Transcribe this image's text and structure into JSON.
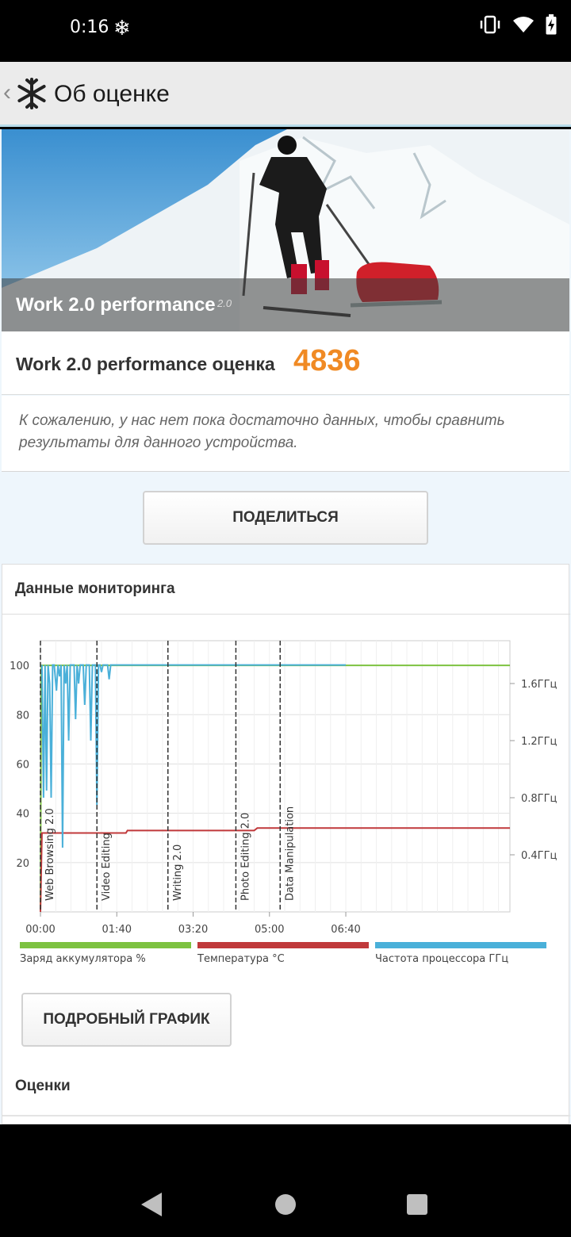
{
  "status_bar": {
    "time": "0:16",
    "icons": [
      "snowflake-notification-icon",
      "vibrate-icon",
      "wifi-icon",
      "battery-charging-icon"
    ]
  },
  "app_bar": {
    "title": "Об оценке"
  },
  "hero": {
    "title": "Work 2.0 performance",
    "version": "2.0"
  },
  "score": {
    "label": "Work 2.0 performance оценка",
    "value": "4836",
    "color": "#f08a24"
  },
  "info": {
    "text": "К сожалению, у нас нет пока достаточно данных, чтобы сравнить результаты для данного устройства."
  },
  "share_button": "ПОДЕЛИТЬСЯ",
  "monitoring": {
    "title": "Данные мониторинга",
    "legend": [
      {
        "label": "Заряд аккумулятора %",
        "color": "#7dc241"
      },
      {
        "label": "Температура °C",
        "color": "#c0393b"
      },
      {
        "label": "Частота процессора ГГц",
        "color": "#4ab0d9"
      }
    ]
  },
  "detail_button": "ПОДРОБНЫЙ ГРАФИК",
  "scores_title": "Оценки",
  "chart_data": {
    "type": "line",
    "x_ticks": [
      "00:00",
      "01:40",
      "03:20",
      "05:00",
      "06:40"
    ],
    "x_range_seconds": [
      0,
      615
    ],
    "y_left_ticks": [
      "20",
      "40",
      "60",
      "80",
      "100"
    ],
    "y_left_range": [
      0,
      110
    ],
    "y_right_ticks": [
      "0.4ГГц",
      "0.8ГГц",
      "1.2ГГц",
      "1.6ГГц"
    ],
    "y_right_range_ghz": [
      0,
      1.9
    ],
    "grid": true,
    "sections": [
      {
        "label": "Web Browsing 2.0",
        "start_seconds": 0
      },
      {
        "label": "Video Editing",
        "start_seconds": 74
      },
      {
        "label": "Writing 2.0",
        "start_seconds": 167
      },
      {
        "label": "Photo Editing 2.0",
        "start_seconds": 256
      },
      {
        "label": "Data Manipulation",
        "start_seconds": 314
      }
    ],
    "series": [
      {
        "name": "Заряд аккумулятора %",
        "color": "#7dc241",
        "axis": "left",
        "points": [
          [
            0,
            0
          ],
          [
            1,
            100
          ],
          [
            615,
            100
          ]
        ]
      },
      {
        "name": "Температура °C",
        "color": "#c0393b",
        "axis": "left",
        "points": [
          [
            0,
            0
          ],
          [
            2,
            32
          ],
          [
            112,
            32
          ],
          [
            114,
            33
          ],
          [
            280,
            33
          ],
          [
            284,
            34
          ],
          [
            615,
            34
          ]
        ]
      },
      {
        "name": "Частота процессора ГГц",
        "color": "#4ab0d9",
        "axis": "right",
        "points": [
          [
            2,
            1.73
          ],
          [
            4,
            0.8
          ],
          [
            6,
            1.73
          ],
          [
            8,
            0.85
          ],
          [
            10,
            1.73
          ],
          [
            12,
            1.6
          ],
          [
            14,
            0.8
          ],
          [
            16,
            1.73
          ],
          [
            18,
            1.73
          ],
          [
            21,
            1.55
          ],
          [
            23,
            1.73
          ],
          [
            25,
            1.65
          ],
          [
            27,
            1.73
          ],
          [
            29,
            0.45
          ],
          [
            31,
            1.73
          ],
          [
            33,
            1.6
          ],
          [
            35,
            1.73
          ],
          [
            37,
            1.2
          ],
          [
            39,
            1.73
          ],
          [
            41,
            1.73
          ],
          [
            44,
            1.73
          ],
          [
            46,
            1.35
          ],
          [
            48,
            1.73
          ],
          [
            50,
            1.6
          ],
          [
            52,
            1.73
          ],
          [
            54,
            1.73
          ],
          [
            56,
            1.73
          ],
          [
            58,
            1.45
          ],
          [
            60,
            1.73
          ],
          [
            62,
            1.73
          ],
          [
            64,
            1.73
          ],
          [
            66,
            1.2
          ],
          [
            68,
            1.73
          ],
          [
            70,
            1.73
          ],
          [
            72,
            1.73
          ],
          [
            74,
            0.75
          ],
          [
            76,
            1.73
          ],
          [
            78,
            1.73
          ],
          [
            80,
            1.68
          ],
          [
            82,
            1.73
          ],
          [
            84,
            1.73
          ],
          [
            86,
            1.73
          ],
          [
            88,
            1.73
          ],
          [
            90,
            1.63
          ],
          [
            92,
            1.73
          ],
          [
            94,
            1.73
          ],
          [
            96,
            1.73
          ],
          [
            98,
            1.73
          ],
          [
            100,
            1.73
          ],
          [
            102,
            1.73
          ],
          [
            104,
            1.73
          ],
          [
            106,
            1.73
          ],
          [
            108,
            1.73
          ],
          [
            110,
            1.73
          ],
          [
            112,
            1.73
          ],
          [
            114,
            1.73
          ],
          [
            116,
            1.73
          ],
          [
            118,
            1.73
          ],
          [
            120,
            1.73
          ],
          [
            122,
            1.73
          ],
          [
            124,
            1.73
          ],
          [
            126,
            1.73
          ],
          [
            128,
            1.73
          ],
          [
            130,
            1.73
          ],
          [
            132,
            1.73
          ],
          [
            134,
            1.73
          ],
          [
            136,
            1.73
          ],
          [
            138,
            1.73
          ],
          [
            140,
            1.73
          ],
          [
            142,
            1.73
          ],
          [
            144,
            1.73
          ],
          [
            146,
            1.73
          ],
          [
            148,
            1.73
          ],
          [
            150,
            1.73
          ],
          [
            152,
            1.73
          ],
          [
            154,
            1.73
          ],
          [
            156,
            1.73
          ],
          [
            158,
            1.73
          ],
          [
            160,
            1.73
          ],
          [
            162,
            1.73
          ],
          [
            164,
            1.73
          ],
          [
            166,
            1.73
          ],
          [
            168,
            1.73
          ],
          [
            170,
            1.73
          ],
          [
            172,
            1.73
          ],
          [
            174,
            1.73
          ],
          [
            176,
            1.73
          ],
          [
            178,
            1.73
          ],
          [
            180,
            1.73
          ],
          [
            182,
            1.73
          ],
          [
            184,
            1.73
          ],
          [
            186,
            1.73
          ],
          [
            188,
            1.73
          ],
          [
            190,
            1.73
          ],
          [
            192,
            1.73
          ],
          [
            194,
            1.73
          ],
          [
            196,
            1.73
          ],
          [
            198,
            1.73
          ],
          [
            200,
            1.73
          ],
          [
            202,
            1.73
          ],
          [
            204,
            1.73
          ],
          [
            206,
            1.73
          ],
          [
            208,
            1.73
          ],
          [
            210,
            1.73
          ],
          [
            212,
            1.73
          ],
          [
            214,
            1.73
          ],
          [
            216,
            1.73
          ],
          [
            218,
            1.73
          ],
          [
            220,
            1.73
          ],
          [
            222,
            1.73
          ],
          [
            224,
            1.73
          ],
          [
            226,
            1.73
          ],
          [
            228,
            1.73
          ],
          [
            230,
            1.73
          ],
          [
            232,
            1.73
          ],
          [
            234,
            1.73
          ],
          [
            236,
            1.73
          ],
          [
            238,
            1.73
          ],
          [
            240,
            1.73
          ],
          [
            242,
            1.73
          ],
          [
            244,
            1.73
          ],
          [
            246,
            1.73
          ],
          [
            248,
            1.73
          ],
          [
            250,
            1.73
          ],
          [
            252,
            1.73
          ],
          [
            254,
            1.73
          ],
          [
            256,
            1.73
          ],
          [
            258,
            1.73
          ],
          [
            260,
            1.73
          ],
          [
            262,
            1.73
          ],
          [
            264,
            1.73
          ],
          [
            266,
            1.73
          ],
          [
            268,
            1.73
          ],
          [
            270,
            1.73
          ],
          [
            272,
            1.73
          ],
          [
            274,
            1.73
          ],
          [
            276,
            1.73
          ],
          [
            278,
            1.73
          ],
          [
            280,
            1.73
          ],
          [
            282,
            1.73
          ],
          [
            284,
            1.73
          ],
          [
            286,
            1.73
          ],
          [
            288,
            1.73
          ],
          [
            290,
            1.73
          ],
          [
            292,
            1.73
          ],
          [
            294,
            1.73
          ],
          [
            296,
            1.73
          ],
          [
            298,
            1.73
          ],
          [
            300,
            1.73
          ],
          [
            302,
            1.73
          ],
          [
            304,
            1.73
          ],
          [
            306,
            1.73
          ],
          [
            308,
            1.73
          ],
          [
            310,
            1.73
          ],
          [
            312,
            1.73
          ],
          [
            314,
            1.73
          ],
          [
            316,
            1.73
          ],
          [
            318,
            1.73
          ],
          [
            320,
            1.73
          ],
          [
            322,
            1.73
          ],
          [
            324,
            1.73
          ],
          [
            326,
            1.73
          ],
          [
            328,
            1.73
          ],
          [
            330,
            1.73
          ],
          [
            332,
            1.73
          ],
          [
            334,
            1.73
          ],
          [
            336,
            1.73
          ],
          [
            338,
            1.73
          ],
          [
            340,
            1.73
          ],
          [
            342,
            1.73
          ],
          [
            344,
            1.73
          ],
          [
            346,
            1.73
          ],
          [
            348,
            1.73
          ],
          [
            350,
            1.73
          ],
          [
            352,
            1.73
          ],
          [
            354,
            1.73
          ],
          [
            356,
            1.73
          ],
          [
            358,
            1.73
          ],
          [
            360,
            1.73
          ],
          [
            362,
            1.73
          ],
          [
            364,
            1.73
          ],
          [
            366,
            1.73
          ],
          [
            368,
            1.73
          ],
          [
            370,
            1.73
          ],
          [
            372,
            1.73
          ],
          [
            374,
            1.73
          ],
          [
            376,
            1.73
          ],
          [
            378,
            1.73
          ],
          [
            380,
            1.73
          ],
          [
            382,
            1.73
          ],
          [
            384,
            1.73
          ],
          [
            386,
            1.73
          ],
          [
            388,
            1.73
          ],
          [
            390,
            1.73
          ],
          [
            392,
            1.73
          ],
          [
            394,
            1.73
          ],
          [
            396,
            1.73
          ],
          [
            398,
            1.73
          ],
          [
            400,
            1.73
          ]
        ]
      }
    ]
  }
}
